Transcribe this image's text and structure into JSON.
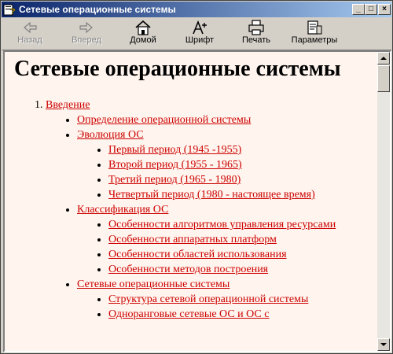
{
  "window": {
    "title": "Сетевые операционные системы"
  },
  "toolbar": {
    "back": "Назад",
    "forward": "Вперед",
    "home": "Домой",
    "font": "Шрифт",
    "print": "Печать",
    "options": "Параметры"
  },
  "page": {
    "heading": "Сетевые операционные системы",
    "item1": {
      "label": "Введение",
      "def": "Определение операционной системы",
      "evo": {
        "label": "Эволюция ОС",
        "p1": "Первый период (1945 -1955)",
        "p2": "Второй период (1955 - 1965)",
        "p3": "Третий период (1965 - 1980)",
        "p4": "Четвертый период (1980 - настоящее время)"
      },
      "cls": {
        "label": "Классификация ОС",
        "c1": "Особенности алгоритмов управления ресурсами",
        "c2": "Особенности аппаратных платформ",
        "c3": "Особенности областей использования",
        "c4": "Особенности методов построения"
      },
      "net": {
        "label": "Сетевые операционные системы",
        "n1": "Структура сетевой операционной системы",
        "n2": "Одноранговые сетевые ОС и ОС с"
      }
    }
  },
  "colors": {
    "link": "#cc0000",
    "background": "#fff5ee",
    "titlebar_start": "#0a246a",
    "titlebar_end": "#a6caf0"
  },
  "icons": [
    "help-window-icon",
    "minimize-icon",
    "maximize-icon",
    "close-icon",
    "back-arrow-icon",
    "forward-arrow-icon",
    "home-icon",
    "font-icon",
    "printer-icon",
    "options-icon",
    "scroll-up-icon",
    "scroll-down-icon"
  ]
}
